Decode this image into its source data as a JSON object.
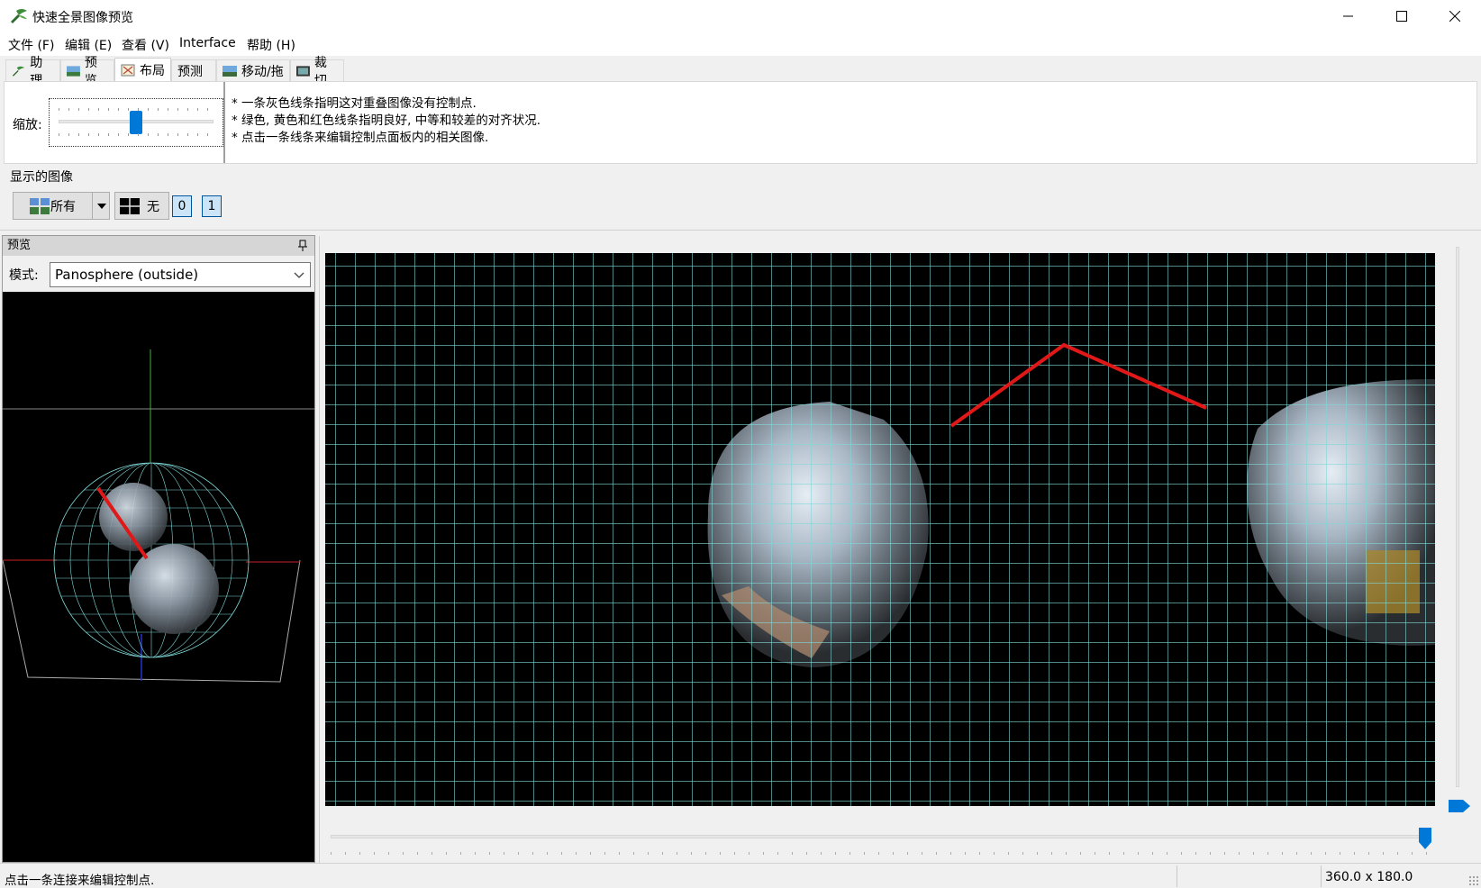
{
  "window": {
    "title": "快速全景图像预览",
    "minimize_glyph": "—",
    "maximize_glyph": "☐",
    "close_glyph": "✕"
  },
  "menu": {
    "file": "文件 (F)",
    "edit": "编辑 (E)",
    "view": "查看 (V)",
    "interface": "Interface",
    "help": "帮助 (H)"
  },
  "tabs": [
    {
      "label": "助理",
      "icon": "wand-icon"
    },
    {
      "label": "预览",
      "icon": "landscape-icon"
    },
    {
      "label": "布局",
      "icon": "layout-icon",
      "active": true
    },
    {
      "label": "预测",
      "icon": ""
    },
    {
      "label": "移动/拖",
      "icon": "move-drag-icon"
    },
    {
      "label": "裁切",
      "icon": "crop-icon"
    }
  ],
  "top_panel": {
    "zoom_label": "缩放:",
    "zoom_level": 0.5,
    "hints": [
      "* 一条灰色线条指明这对重叠图像没有控制点.",
      "* 绿色, 黄色和红色线条指明良好, 中等和较差的对齐状况.",
      "* 点击一条线条来编辑控制点面板内的相关图像."
    ]
  },
  "images_shown": {
    "label": "显示的图像",
    "all_button": "所有",
    "none_button": "无",
    "image_toggles": [
      "0",
      "1"
    ]
  },
  "preview_pane": {
    "title": "预览",
    "mode_label": "模式:",
    "mode_value": "Panosphere (outside)"
  },
  "status": {
    "message": "点击一条连接来编辑控制点.",
    "dimensions": "360.0 x 180.0"
  },
  "colors": {
    "accent": "#0078d7",
    "grid_line": "#7fd8d8",
    "link_line": "#e01818"
  }
}
